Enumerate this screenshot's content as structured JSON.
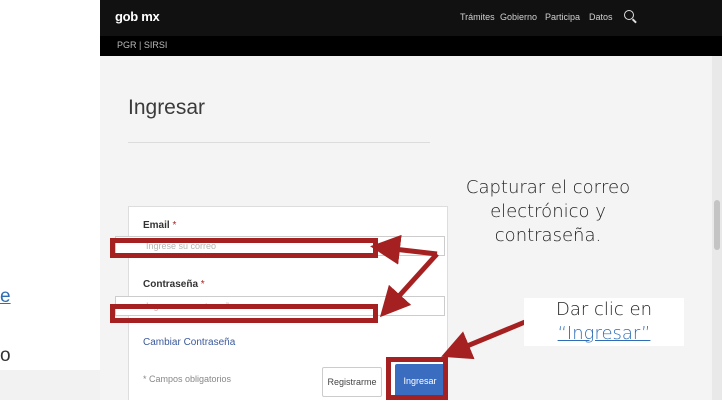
{
  "left_fragment": {
    "line1": "e",
    "line2": "o"
  },
  "topbar": {
    "logo": "gob mx",
    "nav": [
      "Trámites",
      "Gobierno",
      "Participa",
      "Datos"
    ]
  },
  "subbar": {
    "text": "PGR | SIRSI"
  },
  "page": {
    "title": "Ingresar"
  },
  "form": {
    "email_label": "Email",
    "email_required_mark": "*",
    "email_placeholder": "Ingrese su correo",
    "password_label": "Contraseña",
    "password_required_mark": "*",
    "password_placeholder": "Ingrese su contraseña",
    "change_password_link": "Cambiar Contraseña",
    "required_note": "* Campos obligatorios",
    "register_button": "Registrarme",
    "submit_button": "Ingresar"
  },
  "annotations": {
    "callout1": [
      "Capturar el correo",
      "electrónico y",
      "contraseña."
    ],
    "callout2_prefix": "Dar clic en",
    "callout2_link": "“Ingresar”",
    "accent_color": "#a52121",
    "link_color": "#2f6db5"
  },
  "colors": {
    "topbar": "#111111",
    "button_primary": "#3a6cc0"
  }
}
